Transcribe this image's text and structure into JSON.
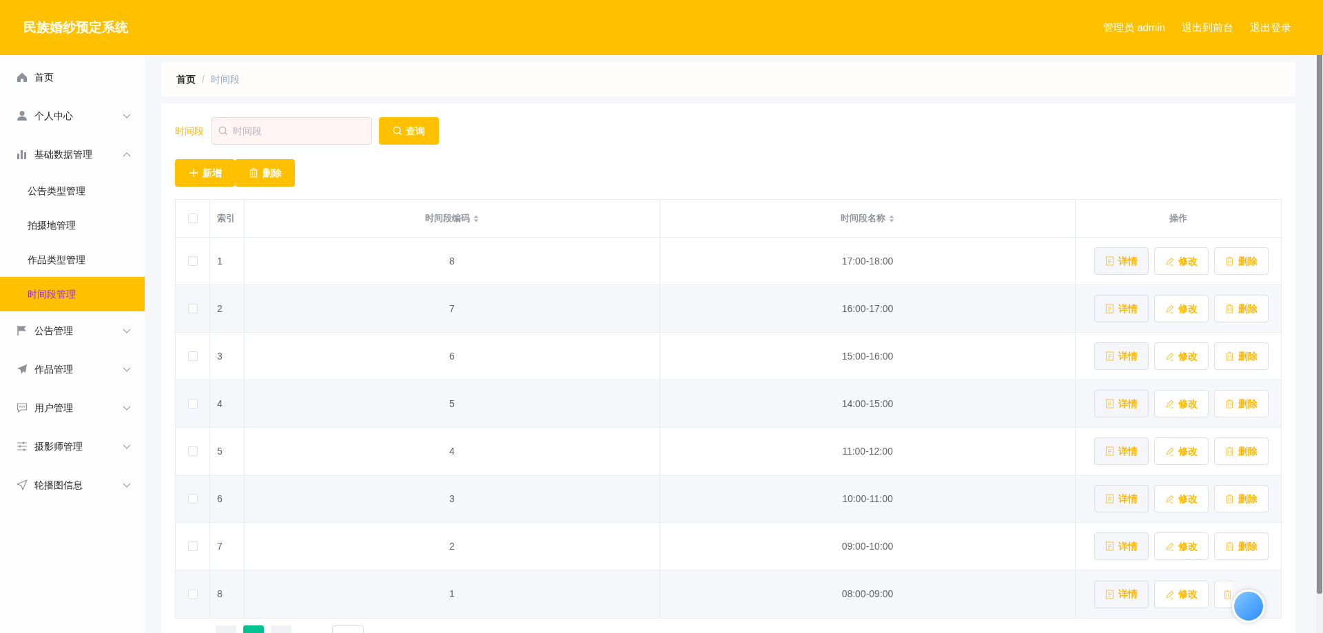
{
  "header": {
    "title": "民族婚纱预定系统",
    "links": [
      "管理员 admin",
      "退出到前台",
      "退出登录"
    ]
  },
  "sidebar": {
    "items": [
      {
        "label": "首页",
        "kind": "link",
        "selected": false
      },
      {
        "label": "个人中心",
        "kind": "group",
        "expanded": false,
        "selected": false
      },
      {
        "label": "基础数据管理",
        "kind": "group",
        "expanded": true,
        "selected": false,
        "children": [
          {
            "label": "公告类型管理",
            "selected": false
          },
          {
            "label": "拍摄地管理",
            "selected": false
          },
          {
            "label": "作品类型管理",
            "selected": false
          },
          {
            "label": "时间段管理",
            "selected": true
          }
        ]
      },
      {
        "label": "公告管理",
        "kind": "group",
        "expanded": false,
        "selected": false
      },
      {
        "label": "作品管理",
        "kind": "group",
        "expanded": false,
        "selected": false
      },
      {
        "label": "用户管理",
        "kind": "group",
        "expanded": false,
        "selected": false
      },
      {
        "label": "摄影师管理",
        "kind": "group",
        "expanded": false,
        "selected": false
      },
      {
        "label": "轮播图信息",
        "kind": "group",
        "expanded": false,
        "selected": false
      }
    ]
  },
  "breadcrumb": {
    "items": [
      "首页",
      "时间段"
    ],
    "separator": "/"
  },
  "search": {
    "label": "时间段",
    "placeholder": "时间段",
    "button": "查询"
  },
  "toolbar": [
    {
      "kind": "add",
      "label": "新增"
    },
    {
      "kind": "delete",
      "label": "删除"
    }
  ],
  "table": {
    "columns": [
      {
        "label": "索引",
        "sortable": false
      },
      {
        "label": "时间段编码",
        "sortable": true
      },
      {
        "label": "时间段名称",
        "sortable": true
      },
      {
        "label": "操作",
        "sortable": false
      }
    ],
    "header_checked": false,
    "rows": [
      {
        "index": "1",
        "code": "8",
        "name": "17:00-18:00",
        "checked": false,
        "actions": [
          {
            "kind": "detail",
            "label": "详情"
          },
          {
            "kind": "edit",
            "label": "修改"
          },
          {
            "kind": "delete",
            "label": "删除"
          }
        ]
      },
      {
        "index": "2",
        "code": "7",
        "name": "16:00-17:00",
        "checked": false,
        "actions": [
          {
            "kind": "detail",
            "label": "详情"
          },
          {
            "kind": "edit",
            "label": "修改"
          },
          {
            "kind": "delete",
            "label": "删除"
          }
        ]
      },
      {
        "index": "3",
        "code": "6",
        "name": "15:00-16:00",
        "checked": false,
        "actions": [
          {
            "kind": "detail",
            "label": "详情"
          },
          {
            "kind": "edit",
            "label": "修改"
          },
          {
            "kind": "delete",
            "label": "删除"
          }
        ]
      },
      {
        "index": "4",
        "code": "5",
        "name": "14:00-15:00",
        "checked": false,
        "actions": [
          {
            "kind": "detail",
            "label": "详情"
          },
          {
            "kind": "edit",
            "label": "修改"
          },
          {
            "kind": "delete",
            "label": "删除"
          }
        ]
      },
      {
        "index": "5",
        "code": "4",
        "name": "11:00-12:00",
        "checked": false,
        "actions": [
          {
            "kind": "detail",
            "label": "详情"
          },
          {
            "kind": "edit",
            "label": "修改"
          },
          {
            "kind": "delete",
            "label": "删除"
          }
        ]
      },
      {
        "index": "6",
        "code": "3",
        "name": "10:00-11:00",
        "checked": false,
        "actions": [
          {
            "kind": "detail",
            "label": "详情"
          },
          {
            "kind": "edit",
            "label": "修改"
          },
          {
            "kind": "delete",
            "label": "删除"
          }
        ]
      },
      {
        "index": "7",
        "code": "2",
        "name": "09:00-10:00",
        "checked": false,
        "actions": [
          {
            "kind": "detail",
            "label": "详情"
          },
          {
            "kind": "edit",
            "label": "修改"
          },
          {
            "kind": "delete",
            "label": "删除"
          }
        ]
      },
      {
        "index": "8",
        "code": "1",
        "name": "08:00-09:00",
        "checked": false,
        "actions": [
          {
            "kind": "detail",
            "label": "详情"
          },
          {
            "kind": "edit",
            "label": "修改"
          },
          {
            "kind": "delete"
          }
        ]
      }
    ]
  },
  "pagination": {
    "pages": [
      {
        "selected": false
      },
      {
        "selected": true
      },
      {
        "selected": false
      }
    ]
  }
}
